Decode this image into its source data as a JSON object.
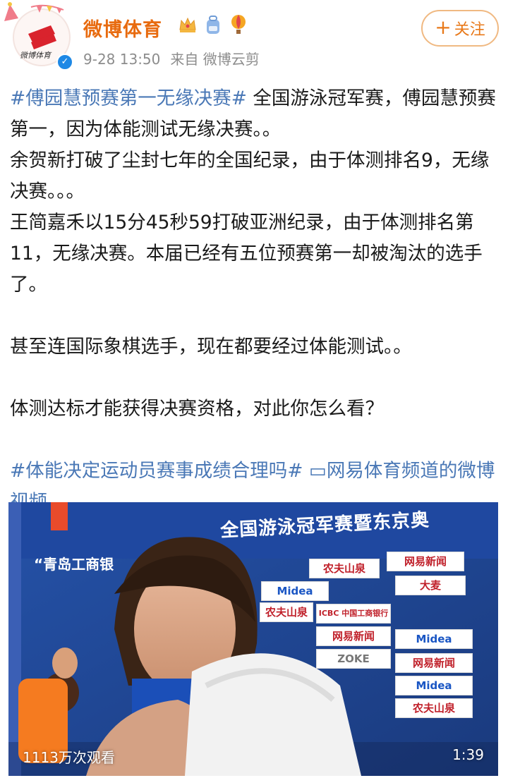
{
  "header": {
    "user_name": "微博体育",
    "avatar_label": "微博体育",
    "timestamp": "9-28 13:50",
    "source": "来自 微博云剪",
    "follow_label": "关注",
    "badges": [
      "crown-icon",
      "backpack-icon",
      "balloon-icon"
    ]
  },
  "post": {
    "tag1": "#傅园慧预赛第一无缘决赛#",
    "line1": "全国游泳冠军赛，傅园慧预赛第一，因为体能测试无缘决赛。。",
    "line2": "余贺新打破了尘封七年的全国纪录，由于体测排名9，无缘决赛。。。",
    "line3": "王简嘉禾以15分45秒59打破亚洲纪录，由于体测排名第11，无缘决赛。本届已经有五位预赛第一却被淘汰的选手了。",
    "line4": "甚至连国际象棋选手，现在都要经过体能测试。。",
    "line5": "体测达标才能获得决赛资格，对此你怎么看？",
    "tag2": "#体能决定运动员赛事成绩合理吗#",
    "video_link": "网易体育频道的微博视频"
  },
  "video": {
    "banner": "全国游泳冠军赛暨东京奥",
    "bank": "“青岛工商银",
    "views": "1113万次观看",
    "duration": "1:39",
    "sponsors": [
      "农夫山泉",
      "网易新闻",
      "Midea",
      "大麦",
      "ICBC 中国工商银行",
      "网易新闻",
      "农夫山泉",
      "Midea",
      "ZOKE",
      "网易新闻",
      "Midea",
      "农夫山泉"
    ]
  },
  "colors": {
    "name": "#e86b0f",
    "link": "#4a78b6",
    "follow_border": "#f0b982",
    "meta": "#8c8c8c"
  }
}
